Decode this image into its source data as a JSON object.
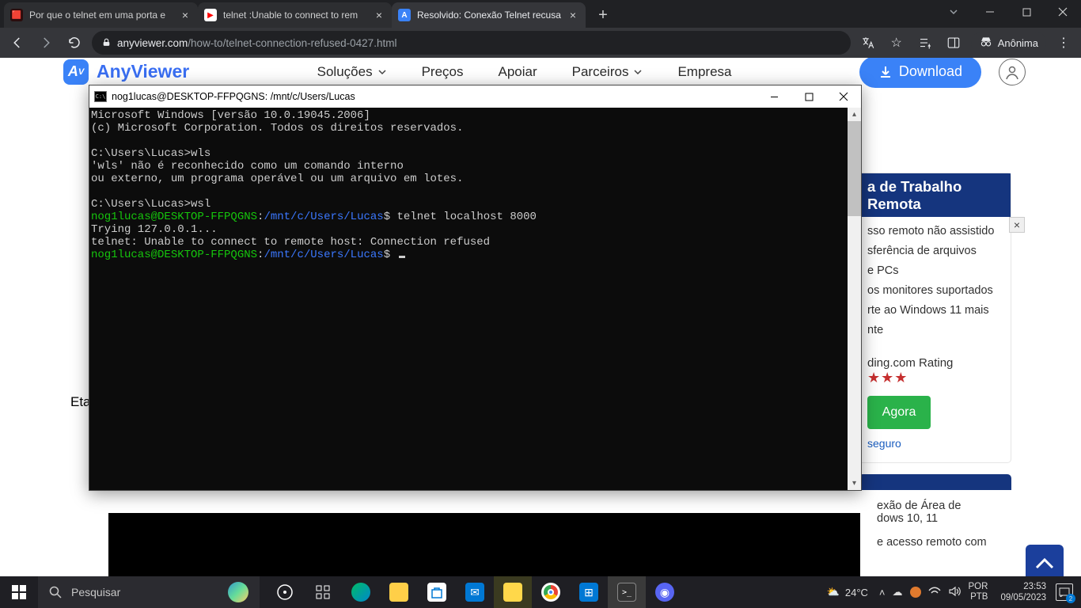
{
  "browser": {
    "tabs": [
      {
        "title": "Por que o telnet em uma porta e",
        "favicon": "#c0392b"
      },
      {
        "title": "telnet :Unable to connect to rem",
        "favicon": "#ff0000"
      },
      {
        "title": "Resolvido: Conexão Telnet recusa",
        "favicon": "#3a82f7",
        "active": true
      }
    ],
    "url_domain": "anyviewer.com",
    "url_path": "/how-to/telnet-connection-refused-0427.html",
    "incognito": "Anônima"
  },
  "page": {
    "brand": "AnyViewer",
    "nav": {
      "solucoes": "Soluções",
      "precos": "Preços",
      "apoiar": "Apoiar",
      "parceiros": "Parceiros",
      "empresa": "Empresa",
      "download": "Download"
    },
    "etapa": "Eta",
    "sidebar": {
      "hero": "a de Trabalho Remota",
      "items": [
        "sso remoto não assistido",
        "sferência de arquivos",
        "e PCs",
        "os monitores suportados",
        "rte ao Windows 11 mais",
        "nte"
      ],
      "rating_label": "ding.com Rating",
      "stars": "★★★",
      "cta": "Agora",
      "secure": "seguro",
      "txt1": "exão de Área de",
      "txt2": "dows 10, 11",
      "txt3": "e acesso remoto com"
    }
  },
  "terminal": {
    "title": "nog1lucas@DESKTOP-FFPQGNS: /mnt/c/Users/Lucas",
    "lines": {
      "l1": "Microsoft Windows [versão 10.0.19045.2006]",
      "l2": "(c) Microsoft Corporation. Todos os direitos reservados.",
      "l3": "C:\\Users\\Lucas>wls",
      "l4": "'wls' não é reconhecido como um comando interno",
      "l5": "ou externo, um programa operável ou um arquivo em lotes.",
      "l6": "C:\\Users\\Lucas>wsl",
      "prompt_user": "nog1lucas@DESKTOP-FFPQGNS",
      "prompt_sep": ":",
      "prompt_path": "/mnt/c/Users/Lucas",
      "prompt_dollar": "$ ",
      "cmd1": "telnet localhost 8000",
      "l7": "Trying 127.0.0.1...",
      "l8": "telnet: Unable to connect to remote host: Connection refused"
    }
  },
  "taskbar": {
    "search_placeholder": "Pesquisar",
    "weather_temp": "24°C",
    "lang1": "POR",
    "lang2": "PTB",
    "time": "23:53",
    "date": "09/05/2023",
    "notif_count": "2"
  }
}
